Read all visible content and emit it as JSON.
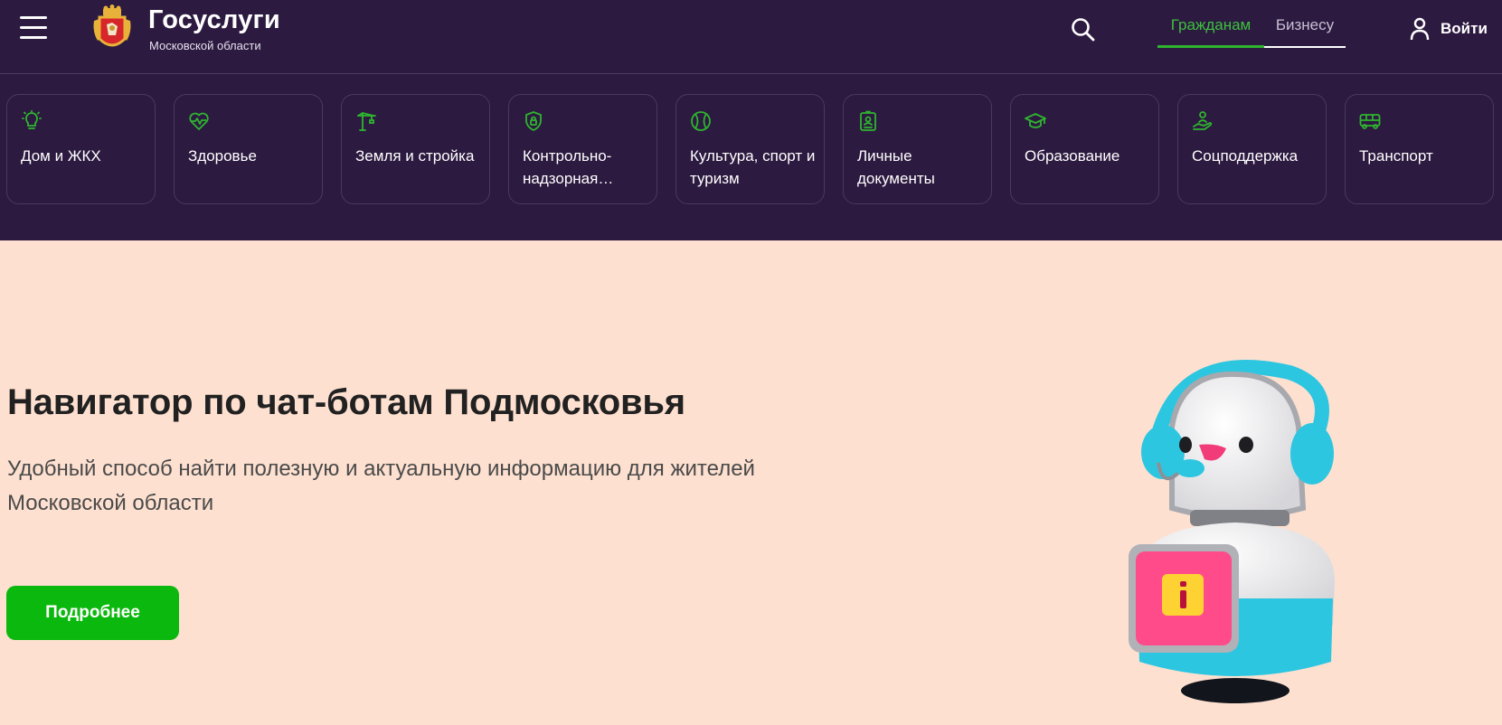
{
  "header": {
    "brand_title": "Госуслуги",
    "brand_subtitle": "Московской области",
    "tabs": [
      {
        "label": "Гражданам",
        "active": true
      },
      {
        "label": "Бизнесу",
        "active": false
      }
    ],
    "login_label": "Войти"
  },
  "categories": [
    {
      "label": "Дом и ЖКХ",
      "icon": "lightbulb-icon"
    },
    {
      "label": "Здоровье",
      "icon": "heart-pulse-icon"
    },
    {
      "label": "Земля и стройка",
      "icon": "crane-icon"
    },
    {
      "label": "Контрольно-надзорная…",
      "icon": "shield-lock-icon"
    },
    {
      "label": "Культура, спорт и туризм",
      "icon": "ball-icon"
    },
    {
      "label": "Личные документы",
      "icon": "id-card-icon"
    },
    {
      "label": "Образование",
      "icon": "graduation-cap-icon"
    },
    {
      "label": "Соцподдержка",
      "icon": "hand-person-icon"
    },
    {
      "label": "Транспорт",
      "icon": "bus-icon"
    }
  ],
  "hero": {
    "title": "Навигатор по чат-ботам Подмосковья",
    "subtitle": "Удобный способ найти полезную и актуальную информацию для жителей Московской области",
    "button_label": "Подробнее"
  },
  "colors": {
    "header_bg": "#2c1a40",
    "accent_green": "#0bb80d",
    "hero_bg": "#fde0d0",
    "icon_green": "#2fb52f"
  }
}
